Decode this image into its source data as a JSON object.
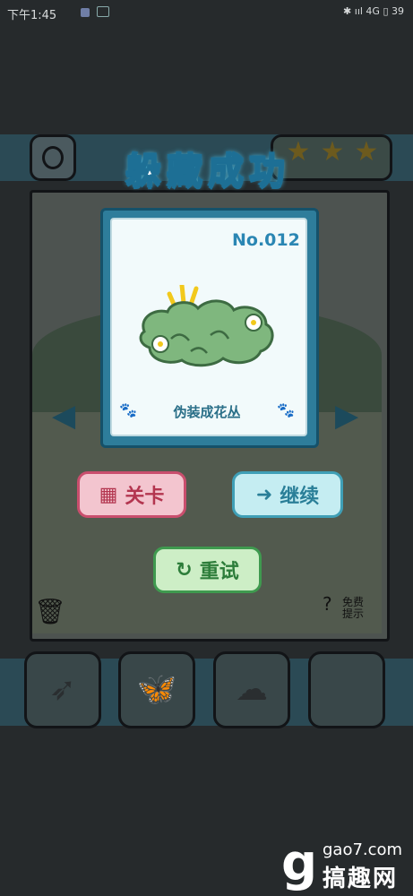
{
  "status_bar": {
    "time": "下午1:45",
    "right_icons": "✱ ııl 4G ▯ 39"
  },
  "game": {
    "stars": [
      "★",
      "★",
      "★"
    ],
    "left_arrow": "◀",
    "right_arrow": "▶",
    "trash_icon": "🗑",
    "hint_label": "免费\n提示",
    "slots": [
      {
        "name": "dart",
        "icon": "➶"
      },
      {
        "name": "butterfly",
        "icon": "🦋"
      },
      {
        "name": "bush",
        "icon": "☁"
      },
      {
        "name": "empty",
        "icon": ""
      }
    ]
  },
  "dialog": {
    "title": "躲藏成功",
    "card": {
      "number": "No.012",
      "name": "伪装成花丛",
      "paw": "🐾"
    },
    "buttons": {
      "level_label": "关卡",
      "level_icon": "▦",
      "continue_label": "继续",
      "continue_icon": "➜",
      "retry_label": "重试",
      "retry_icon": "↻"
    }
  },
  "watermark": {
    "logo": "g",
    "site": "gao7.com",
    "name": "搞趣网"
  },
  "colors": {
    "card_accent": "#2e7d9b",
    "level_button": "#f3c5cf",
    "continue_button": "#c5edf2",
    "retry_button": "#cdeec6"
  }
}
